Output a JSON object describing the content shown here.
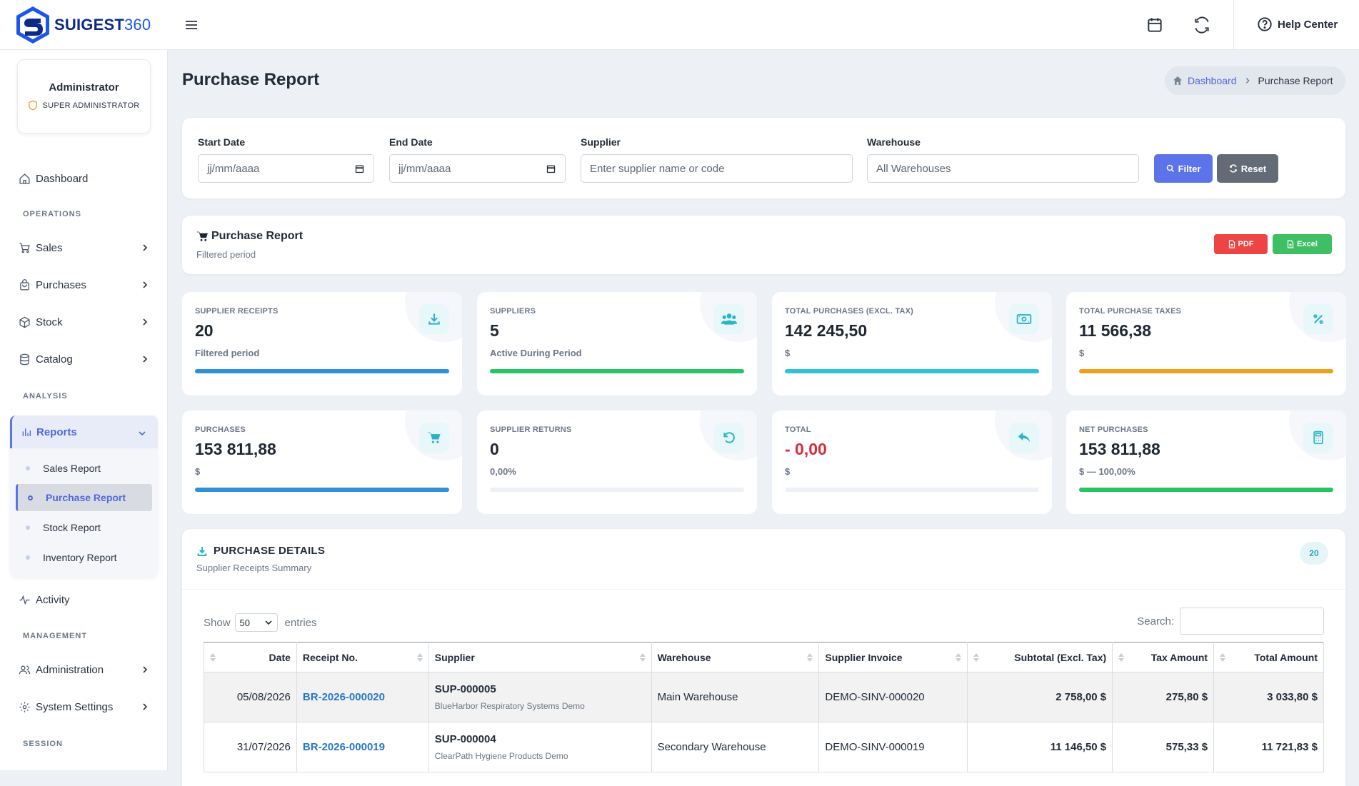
{
  "brand": {
    "name": "SUIGEST",
    "number": "360"
  },
  "header": {
    "help_center": "Help Center"
  },
  "user": {
    "name": "Administrator",
    "role": "SUPER ADMINISTRATOR"
  },
  "nav": {
    "dashboard": "Dashboard",
    "section_operations": "OPERATIONS",
    "sales": "Sales",
    "purchases": "Purchases",
    "stock": "Stock",
    "catalog": "Catalog",
    "section_analysis": "ANALYSIS",
    "reports": "Reports",
    "reports_items": [
      "Sales Report",
      "Purchase Report",
      "Stock Report",
      "Inventory Report"
    ],
    "activity": "Activity",
    "section_management": "MANAGEMENT",
    "administration": "Administration",
    "system_settings": "System Settings",
    "section_session": "SESSION"
  },
  "page": {
    "title": "Purchase Report"
  },
  "breadcrumb": {
    "home": "Dashboard",
    "current": "Purchase Report"
  },
  "filters": {
    "start_label": "Start Date",
    "start_placeholder": "jj/mm/aaaa",
    "end_label": "End Date",
    "end_placeholder": "jj/mm/aaaa",
    "supplier_label": "Supplier",
    "supplier_placeholder": "Enter supplier name or code",
    "warehouse_label": "Warehouse",
    "warehouse_value": "All Warehouses",
    "filter_btn": "Filter",
    "reset_btn": "Reset"
  },
  "report": {
    "title": "Purchase Report",
    "subtitle": "Filtered period",
    "pdf": "PDF",
    "excel": "Excel"
  },
  "stats": [
    {
      "label": "SUPPLIER RECEIPTS",
      "value": "20",
      "sub": "Filtered period",
      "progress": 1.0,
      "color": "#2f8fd8",
      "icon": "download-icon"
    },
    {
      "label": "SUPPLIERS",
      "value": "5",
      "sub": "Active During Period",
      "progress": 1.0,
      "color": "#27c465",
      "icon": "users-icon"
    },
    {
      "label": "TOTAL PURCHASES (EXCL. TAX)",
      "value": "142 245,50",
      "sub": "$",
      "progress": 1.0,
      "color": "#2ec3cf",
      "icon": "money-icon"
    },
    {
      "label": "TOTAL PURCHASE TAXES",
      "value": "11 566,38",
      "sub": "$",
      "progress": 1.0,
      "color": "#efa01a",
      "icon": "percent-icon"
    },
    {
      "label": "PURCHASES",
      "value": "153 811,88",
      "sub": "$",
      "progress": 1.0,
      "color": "#2f8fd8",
      "icon": "cart-icon"
    },
    {
      "label": "SUPPLIER RETURNS",
      "value": "0",
      "sub": "0,00%",
      "progress": 0.0,
      "color": "#2ec3cf",
      "icon": "undo-icon"
    },
    {
      "label": "TOTAL",
      "value": "- 0,00",
      "sub": "$",
      "progress": 0.0,
      "color": "#2f8fd8",
      "icon": "reply-icon",
      "negative": true
    },
    {
      "label": "NET PURCHASES",
      "value": "153 811,88",
      "sub": "$ — 100,00%",
      "progress": 1.0,
      "color": "#27c465",
      "icon": "calculator-icon"
    }
  ],
  "details": {
    "title": "PURCHASE DETAILS",
    "subtitle": "Supplier Receipts Summary",
    "count": "20",
    "show_label": "Show",
    "entries_value": "50",
    "entries_label": "entries",
    "search_label": "Search:",
    "columns": [
      "Date",
      "Receipt No.",
      "Supplier",
      "Warehouse",
      "Supplier Invoice",
      "Subtotal (Excl. Tax)",
      "Tax Amount",
      "Total Amount"
    ],
    "rows": [
      {
        "date": "05/08/2026",
        "receipt": "BR-2026-000020",
        "supplier_code": "SUP-000005",
        "supplier_name": "BlueHarbor Respiratory Systems Demo",
        "warehouse": "Main Warehouse",
        "invoice": "DEMO-SINV-000020",
        "subtotal": "2 758,00 $",
        "tax": "275,80 $",
        "total": "3 033,80 $"
      },
      {
        "date": "31/07/2026",
        "receipt": "BR-2026-000019",
        "supplier_code": "SUP-000004",
        "supplier_name": "ClearPath Hygiene Products Demo",
        "warehouse": "Secondary Warehouse",
        "invoice": "DEMO-SINV-000019",
        "subtotal": "11 146,50 $",
        "tax": "575,33 $",
        "total": "11 721,83 $"
      }
    ]
  }
}
